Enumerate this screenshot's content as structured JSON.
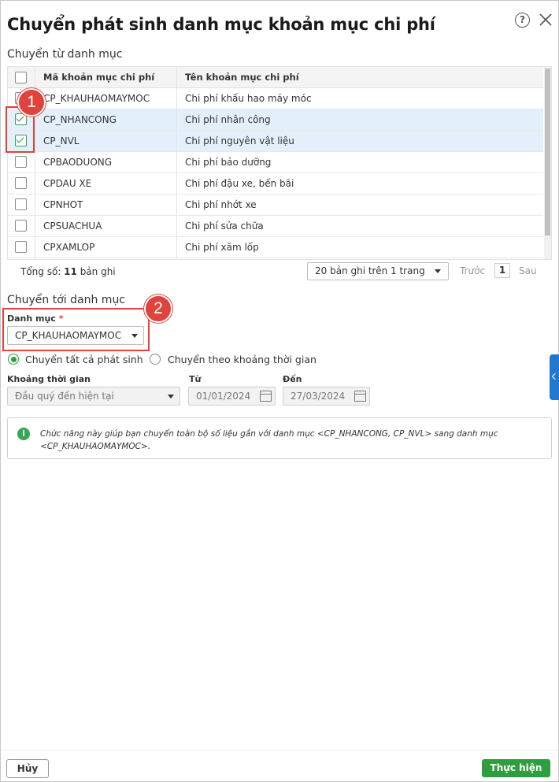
{
  "dialog": {
    "title": "Chuyển phát sinh danh mục khoản mục chi phí",
    "help_icon": "?"
  },
  "source": {
    "label": "Chuyển từ danh mục",
    "columns": [
      "Mã khoản mục chi phí",
      "Tên khoản mục chi phí"
    ],
    "rows": [
      {
        "code": "CP_KHAUHAOMAYMOC",
        "name": "Chi phí khấu hao máy móc",
        "checked": false
      },
      {
        "code": "CP_NHANCONG",
        "name": "Chi phí nhân công",
        "checked": true
      },
      {
        "code": "CP_NVL",
        "name": "Chi phí nguyên vật liệu",
        "checked": true
      },
      {
        "code": "CPBAODUONG",
        "name": "Chi phí bảo dưỡng",
        "checked": false
      },
      {
        "code": "CPDAU XE",
        "name": "Chi phí đậu xe, bến bãi",
        "checked": false
      },
      {
        "code": "CPNHOT",
        "name": "Chi phí nhớt xe",
        "checked": false
      },
      {
        "code": "CPSUACHUA",
        "name": "Chi phí sửa chữa",
        "checked": false
      },
      {
        "code": "CPXAMLOP",
        "name": "Chi phí xăm lốp",
        "checked": false
      }
    ],
    "total_prefix": "Tổng số: ",
    "total_count": "11",
    "total_suffix": " bản ghi",
    "page_size": "20 bản ghi trên 1 trang",
    "prev": "Trước",
    "page": "1",
    "next": "Sau"
  },
  "target": {
    "label": "Chuyển tới danh mục",
    "category_label": "Danh mục",
    "required_mark": "*",
    "category_value": "CP_KHAUHAOMAYMOC",
    "radio_all": "Chuyển tất cả phát sinh",
    "radio_period": "Chuyển theo khoảng thời gian",
    "period_label": "Khoảng thời gian",
    "period_value": "Đầu quý đến hiện tại",
    "from_label": "Từ",
    "from_value": "01/01/2024",
    "to_label": "Đến",
    "to_value": "27/03/2024"
  },
  "info": {
    "icon": "i",
    "text": "Chức năng này giúp bạn chuyển toàn bộ số liệu gắn với danh mục <CP_NHANCONG, CP_NVL> sang danh mục <CP_KHAUHAOMAYMOC>."
  },
  "markers": {
    "one": "1",
    "two": "2"
  },
  "buttons": {
    "cancel": "Hủy",
    "submit": "Thực hiện"
  },
  "colors": {
    "accent": "#2e9e3e",
    "marker": "#e0423c",
    "selected_row": "#e3f0fb",
    "side_tab": "#1f78d1"
  }
}
